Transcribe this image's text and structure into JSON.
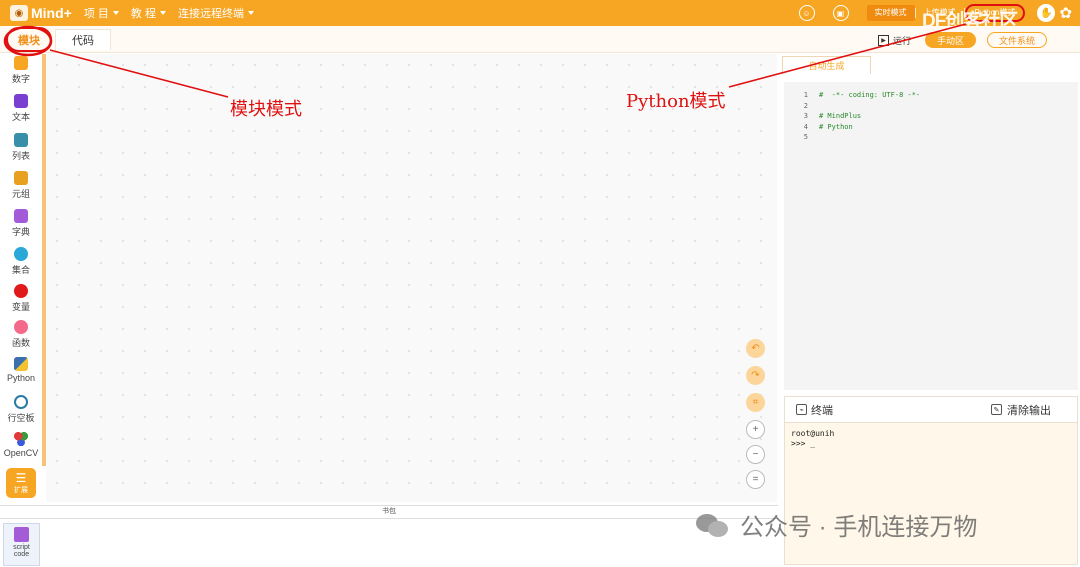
{
  "topbar": {
    "logo": "Mind+",
    "menu": [
      {
        "label": "项 目"
      },
      {
        "label": "教 程"
      },
      {
        "label": "连接远程终端"
      }
    ],
    "modes": {
      "realtime": "实时模式",
      "upload": "上传模式",
      "python": "Python模式"
    }
  },
  "watermark_top": "DF创客社区",
  "subbar": {
    "tab_blocks": "模块",
    "tab_code": "代码",
    "run": "运行",
    "hand_area": "手动区",
    "file_system": "文件系统"
  },
  "sidebar": {
    "categories": [
      {
        "label": "数字",
        "color": "#f6a623"
      },
      {
        "label": "文本",
        "color": "#7a3fd0"
      },
      {
        "label": "列表",
        "color": "#3a8fa8"
      },
      {
        "label": "元组",
        "color": "#e8a020"
      },
      {
        "label": "字典",
        "color": "#a45bd8"
      },
      {
        "label": "集合",
        "color": "#2aa8d8"
      },
      {
        "label": "变量",
        "color": "#e01a1a"
      },
      {
        "label": "函数",
        "color": "#f56a8a"
      },
      {
        "label": "Python",
        "color": "#3a6fb0"
      },
      {
        "label": "行空板",
        "color": "#2a7aa8"
      },
      {
        "label": "OpenCV",
        "color": "#e03a3a"
      }
    ],
    "extension": "扩展"
  },
  "bottom": {
    "bag_title": "书包",
    "script_tile": {
      "line1": "script",
      "line2": "code"
    }
  },
  "code_panel": {
    "tab": "自动生成",
    "lines": [
      {
        "n": "1",
        "text": "#  -*- coding: UTF-8 -*-"
      },
      {
        "n": "2",
        "text": ""
      },
      {
        "n": "3",
        "text": "# MindPlus"
      },
      {
        "n": "4",
        "text": "# Python"
      },
      {
        "n": "5",
        "text": ""
      }
    ]
  },
  "terminal": {
    "title": "终端",
    "clear": "清除输出",
    "lines": [
      "root@unih",
      ">>> _"
    ]
  },
  "annotations": {
    "blocks_mode": "模块模式",
    "python_mode": "Python模式"
  },
  "watermark_bottom": "公众号 · 手机连接万物",
  "colors": {
    "accent": "#f6a623",
    "annotation": "#e01010"
  }
}
